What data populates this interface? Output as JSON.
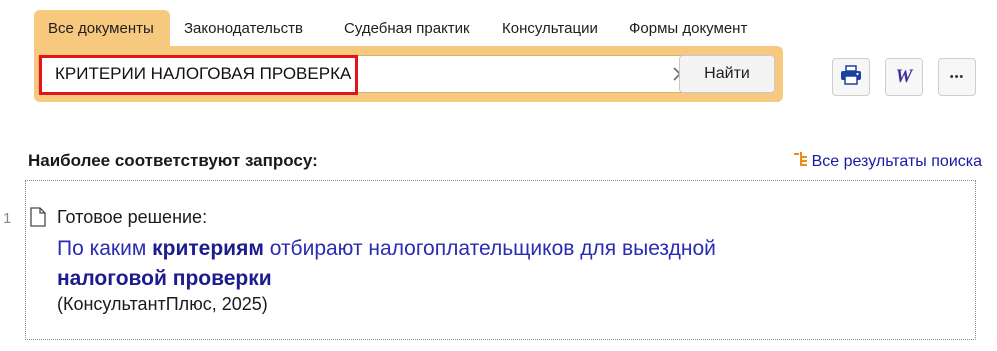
{
  "tabs": [
    {
      "label": "Все документы",
      "active": true
    },
    {
      "label": "Законодательств",
      "active": false
    },
    {
      "label": "Судебная практик",
      "active": false
    },
    {
      "label": "Консультации",
      "active": false
    },
    {
      "label": "Формы документ",
      "active": false
    }
  ],
  "search": {
    "value": "КРИТЕРИИ НАЛОГОВАЯ ПРОВЕРКА",
    "find_label": "Найти"
  },
  "toolbar": {
    "print_icon": "print-icon",
    "word_icon": "word-icon",
    "more_icon": "more-icon",
    "word_glyph": "W",
    "more_glyph": "•••"
  },
  "results": {
    "title": "Наиболее соответствуют запросу:",
    "all_results_label": "Все результаты поиска",
    "items": [
      {
        "number": "1",
        "type": "Готовое решение:",
        "title_parts": [
          {
            "text": "По каким ",
            "bold": false
          },
          {
            "text": "критериям",
            "bold": true
          },
          {
            "text": " отбирают налогоплательщиков для выездной ",
            "bold": false
          },
          {
            "text": "налоговой проверки",
            "bold": true
          }
        ],
        "source": "(КонсультантПлюс, 2025)"
      }
    ]
  },
  "colors": {
    "accent": "#f7c97f",
    "link": "#2b2bb3",
    "highlight": "#e5141c"
  }
}
